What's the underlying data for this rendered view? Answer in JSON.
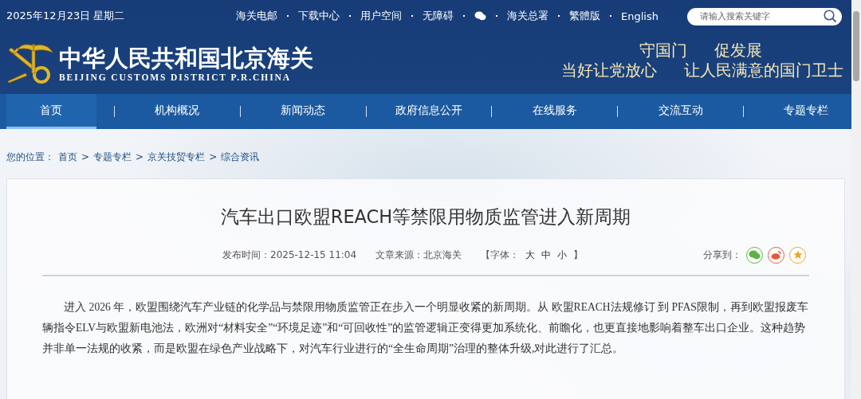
{
  "header": {
    "date": "2025年12月23日 星期二",
    "links": [
      {
        "kind": "text",
        "label": "海关电邮"
      },
      {
        "kind": "text",
        "label": "下载中心"
      },
      {
        "kind": "text",
        "label": "用户空间"
      },
      {
        "kind": "text",
        "label": "无障碍"
      },
      {
        "kind": "wechat"
      },
      {
        "kind": "text",
        "label": "海关总署"
      },
      {
        "kind": "text",
        "label": "繁體版"
      },
      {
        "kind": "text",
        "label": "English"
      }
    ],
    "search": {
      "placeholder": "请输入搜索关键字"
    },
    "logo": {
      "title": "中华人民共和国北京海关",
      "subtitle": "BEIJING CUSTOMS DISTRICT P.R.CHINA"
    },
    "slogan": [
      [
        "守国门",
        "促发展"
      ],
      [
        "当好让党放心",
        "让人民满意的国门卫士"
      ]
    ]
  },
  "nav": [
    {
      "label": "首页",
      "selected": true
    },
    {
      "label": "机构概况",
      "selected": false
    },
    {
      "label": "新闻动态",
      "selected": false
    },
    {
      "label": "政府信息公开",
      "selected": false
    },
    {
      "label": "在线服务",
      "selected": false
    },
    {
      "label": "交流互动",
      "selected": false
    },
    {
      "label": "专题专栏",
      "selected": false
    }
  ],
  "breadcrumb": {
    "label": "您的位置：",
    "separator": ">",
    "items": [
      "首页",
      "专题专栏",
      "京关技贸专栏",
      "综合资讯"
    ]
  },
  "article": {
    "title": "汽车出口欧盟REACH等禁限用物质监管进入新周期",
    "published": "发布时间：2025-12-15 11:04",
    "source": "文章来源：北京海关",
    "font_size": {
      "open": "【字体：",
      "options": [
        "大",
        "中",
        "小"
      ],
      "close": "】"
    },
    "share": {
      "label": "分享到：",
      "targets": [
        {
          "kind": "wechat",
          "color": "#5bb543"
        },
        {
          "kind": "weibo",
          "color": "#e8553a"
        },
        {
          "kind": "favorite",
          "color": "#f2a51c"
        }
      ]
    },
    "body": "进入 2026 年，欧盟围绕汽车产业链的化学品与禁限用物质监管正在步入一个明显收紧的新周期。从 欧盟REACH法规修订 到 PFAS限制，再到欧盟报废车辆指令ELV与欧盟新电池法，欧洲对“材料安全”“环境足迹”和“可回收性”的监管逻辑正变得更加系统化、前瞻化，也更直接地影响着整车出口企业。这种趋势并非单一法规的收紧，而是欧盟在绿色产业战略下，对汽车行业进行的“全生命周期”治理的整体升级,对此进行了汇总。"
  }
}
